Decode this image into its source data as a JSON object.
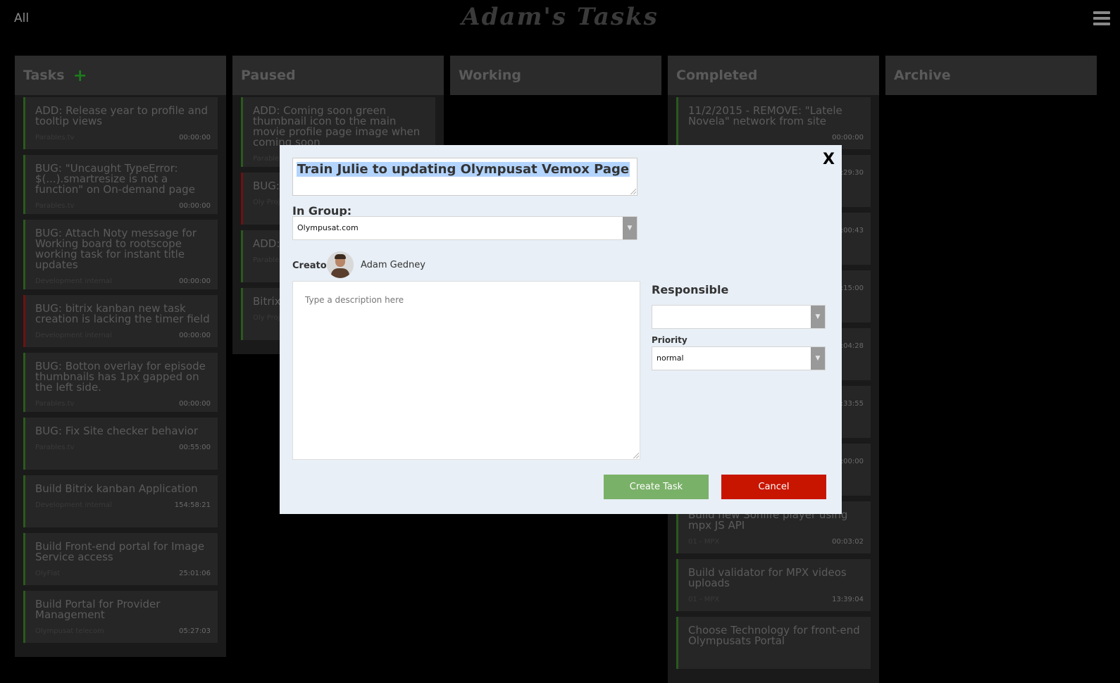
{
  "header": {
    "filter_label": "All",
    "app_title": "Adam's Tasks",
    "menu_icon": "hamburger-menu-icon"
  },
  "columns": [
    {
      "title": "Tasks",
      "has_add": true,
      "add_glyph": "+",
      "cards": [
        {
          "title": "ADD: Release year to profile and tooltip views",
          "group": "Parables.tv",
          "time": "00:00:00",
          "accent": "green"
        },
        {
          "title": "BUG: \"Uncaught TypeError: $(...).smartresize is not a function\" on On-demand page",
          "group": "Parables.tv",
          "time": "00:00:00",
          "accent": "green"
        },
        {
          "title": "BUG: Attach Noty message for Working board to rootscope working task for instant title updates",
          "group": "Development internal",
          "time": "00:00:00",
          "accent": "green"
        },
        {
          "title": "BUG: bitrix kanban new task creation is lacking the timer field",
          "group": "Development internal",
          "time": "00:00:00",
          "accent": "red"
        },
        {
          "title": "BUG: Botton overlay for episode thumbnails has 1px gapped on the left side.",
          "group": "Parables.tv",
          "time": "00:00:00",
          "accent": "green"
        },
        {
          "title": "BUG: Fix Site checker behavior",
          "group": "Parables.tv",
          "time": "00:55:00",
          "accent": "green"
        },
        {
          "title": "Build Bitrix kanban Application",
          "group": "Development internal",
          "time": "154:58:21",
          "accent": "green"
        },
        {
          "title": "Build Front-end portal for Image Service access",
          "group": "OlyFlat",
          "time": "25:01:06",
          "accent": "green"
        },
        {
          "title": "Build Portal for Provider Management",
          "group": "Olympusat telecom",
          "time": "05:27:03",
          "accent": "green"
        }
      ]
    },
    {
      "title": "Paused",
      "has_add": false,
      "cards": [
        {
          "title": "ADD: Coming soon green thumbnail icon to the main movie profile page image when coming soon",
          "group": "Parables.tv",
          "time": "",
          "accent": "green"
        },
        {
          "title": "BUG: bitrix app is saved",
          "group": "Oly Proj",
          "time": "",
          "accent": "red"
        },
        {
          "title": "ADD: episo",
          "group": "Parables.tv",
          "time": "",
          "accent": "green"
        },
        {
          "title": "Bitrix editin",
          "group": "Oly Proj",
          "time": "",
          "accent": "green"
        }
      ]
    },
    {
      "title": "Working",
      "has_add": false,
      "cards": []
    },
    {
      "title": "Completed",
      "has_add": false,
      "cards": [
        {
          "title": "11/2/2015 - REMOVE: \"Latele Novela\" network from site",
          "group": "",
          "time": "00:00:00",
          "accent": "green"
        },
        {
          "title": "",
          "group": "",
          "time": "00:29:30",
          "accent": "green"
        },
        {
          "title": "",
          "group": "",
          "time": "00:00:43",
          "accent": "green"
        },
        {
          "title": "",
          "group": "",
          "time": "00:15:00",
          "accent": "green"
        },
        {
          "title": "",
          "group": "",
          "time": "00:04:28",
          "accent": "green"
        },
        {
          "title": "",
          "group": "",
          "time": "00:33:55",
          "accent": "green"
        },
        {
          "title": "",
          "group": "",
          "time": "00:00:00",
          "accent": "green"
        },
        {
          "title": "Build new Sonlife player using mpx JS API",
          "group": "01 - MPX",
          "time": "00:03:02",
          "accent": "green"
        },
        {
          "title": "Build validator for MPX videos uploads",
          "group": "01 - MPX",
          "time": "13:39:04",
          "accent": "green"
        },
        {
          "title": "Choose Technology for front-end Olympusats Portal",
          "group": "",
          "time": "",
          "accent": "green"
        }
      ]
    },
    {
      "title": "Archive",
      "has_add": false,
      "cards": []
    }
  ],
  "modal": {
    "close_label": "X",
    "task_title": "Train Julie to updating Olympusat Vemox Page",
    "group_label": "In Group:",
    "group_value": "Olympusat.com",
    "creator_label": "Creator",
    "creator_name": "Adam Gedney",
    "description_placeholder": "Type a description here",
    "responsible_label": "Responsible",
    "responsible_value": "",
    "priority_label": "Priority",
    "priority_value": "normal",
    "create_button": "Create Task",
    "cancel_button": "Cancel",
    "colors": {
      "create": "#7ab168",
      "cancel": "#c81500",
      "modal_bg": "#e8eff6"
    }
  }
}
